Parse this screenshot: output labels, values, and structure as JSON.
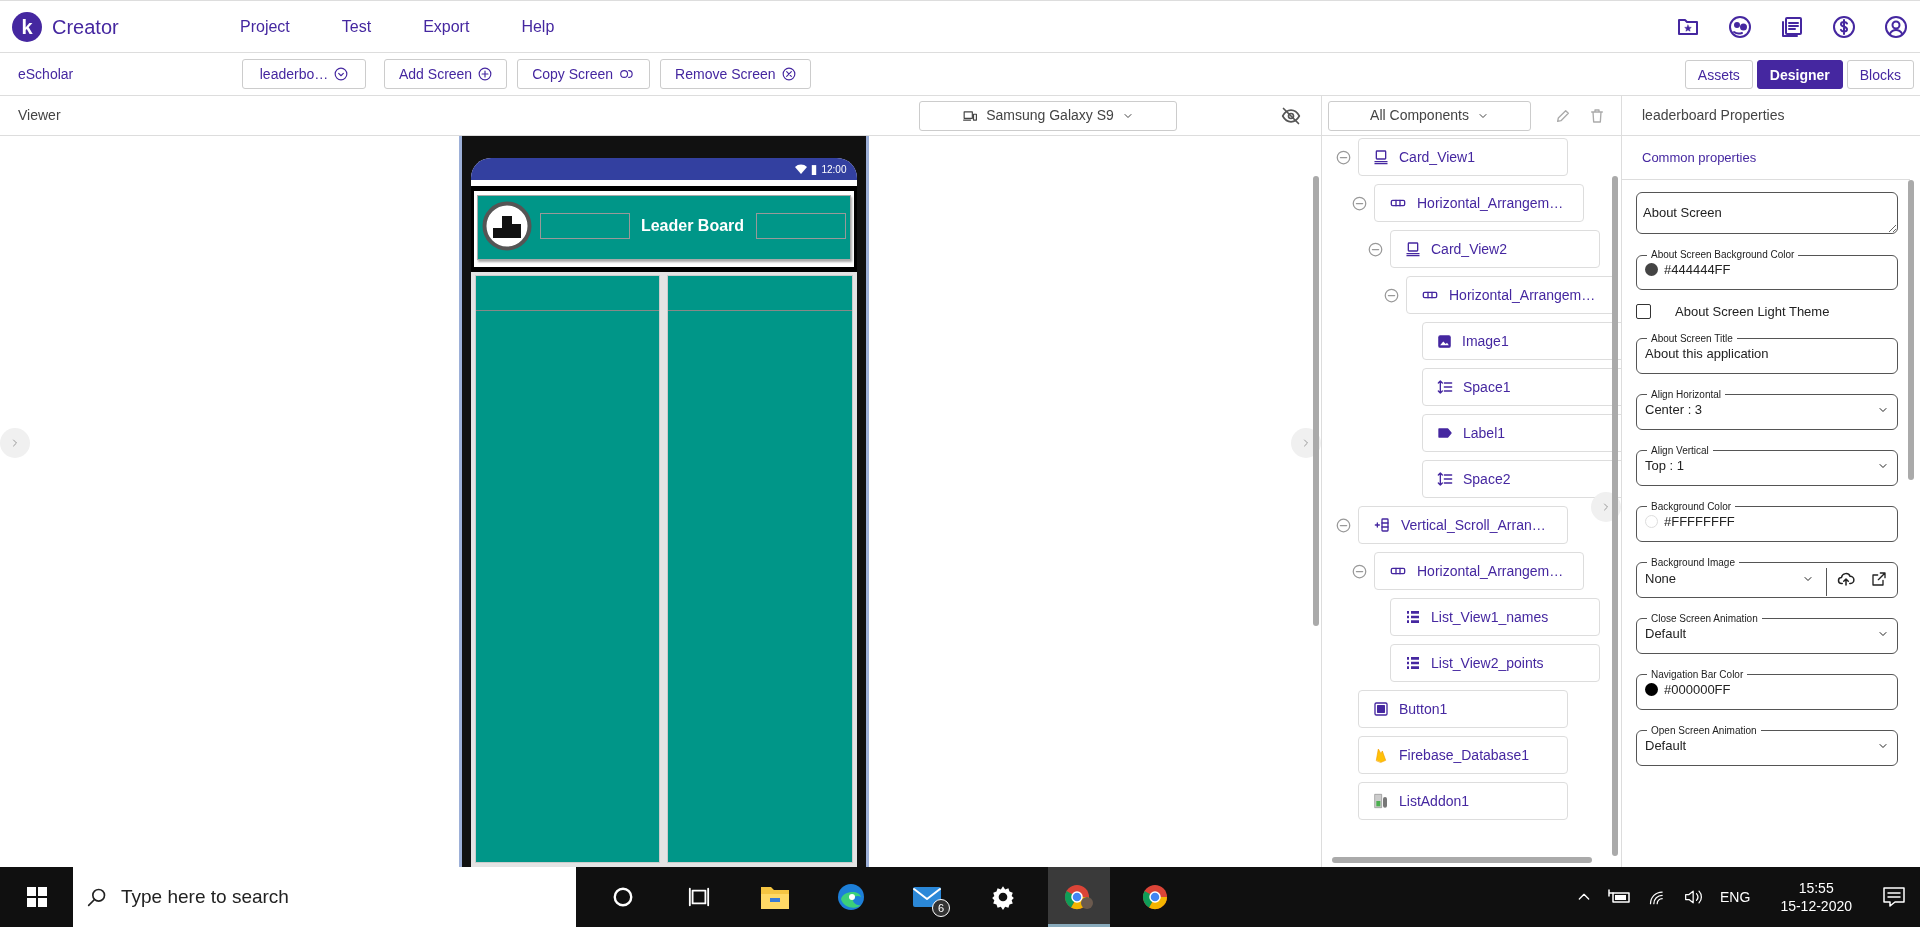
{
  "app": {
    "logo_letter": "k",
    "name": "Creator"
  },
  "menu": [
    "Project",
    "Test",
    "Export",
    "Help"
  ],
  "toolbar": {
    "project": "eScholar",
    "screen_select": "leaderbo…",
    "buttons": [
      {
        "label": "Add Screen",
        "kind": "add"
      },
      {
        "label": "Copy Screen",
        "kind": "copy"
      },
      {
        "label": "Remove Screen",
        "kind": "remove"
      }
    ],
    "views": [
      {
        "label": "Assets",
        "selected": false
      },
      {
        "label": "Designer",
        "selected": true
      },
      {
        "label": "Blocks",
        "selected": false
      }
    ]
  },
  "viewer": {
    "title": "Viewer",
    "device": "Samsung Galaxy S9",
    "phone": {
      "time": "12:00",
      "header_title": "Leader Board"
    }
  },
  "components": {
    "filter": "All Components",
    "tree": [
      {
        "label": "Card_View1",
        "kind": "card",
        "expanded": true,
        "children": [
          {
            "label": "Horizontal_Arrangem…",
            "kind": "horizontal",
            "expanded": true,
            "children": [
              {
                "label": "Card_View2",
                "kind": "card",
                "expanded": true,
                "children": [
                  {
                    "label": "Horizontal_Arrangem…",
                    "kind": "horizontal",
                    "expanded": true,
                    "children": [
                      {
                        "label": "Image1",
                        "kind": "image"
                      },
                      {
                        "label": "Space1",
                        "kind": "space"
                      },
                      {
                        "label": "Label1",
                        "kind": "label"
                      },
                      {
                        "label": "Space2",
                        "kind": "space"
                      }
                    ]
                  }
                ]
              }
            ]
          }
        ]
      },
      {
        "label": "Vertical_Scroll_Arran…",
        "kind": "vertical-scroll",
        "expanded": true,
        "children": [
          {
            "label": "Horizontal_Arrangem…",
            "kind": "horizontal",
            "expanded": true,
            "children": [
              {
                "label": "List_View1_names",
                "kind": "list"
              },
              {
                "label": "List_View2_points",
                "kind": "list"
              }
            ]
          }
        ]
      },
      {
        "label": "Button1",
        "kind": "button"
      },
      {
        "label": "Firebase_Database1",
        "kind": "firebase"
      },
      {
        "label": "ListAddon1",
        "kind": "addon"
      }
    ]
  },
  "properties": {
    "title": "leaderboard Properties",
    "tab": "Common properties",
    "fields": [
      {
        "kind": "textarea",
        "placeholder": "About Screen"
      },
      {
        "kind": "color",
        "label": "About Screen Background Color",
        "value": "#444444FF",
        "color": "#444444"
      },
      {
        "kind": "checkbox",
        "label": "About Screen Light Theme",
        "checked": false
      },
      {
        "kind": "text",
        "label": "About Screen Title",
        "value": "About this application"
      },
      {
        "kind": "select",
        "label": "Align Horizontal",
        "value": "Center : 3"
      },
      {
        "kind": "select",
        "label": "Align Vertical",
        "value": "Top : 1"
      },
      {
        "kind": "color",
        "label": "Background Color",
        "value": "#FFFFFFFF",
        "color": "#ffffff"
      },
      {
        "kind": "image",
        "label": "Background Image",
        "value": "None"
      },
      {
        "kind": "select",
        "label": "Close Screen Animation",
        "value": "Default"
      },
      {
        "kind": "color",
        "label": "Navigation Bar Color",
        "value": "#000000FF",
        "color": "#000000"
      },
      {
        "kind": "select",
        "label": "Open Screen Animation",
        "value": "Default"
      }
    ]
  },
  "taskbar": {
    "search_placeholder": "Type here to search",
    "apps": [
      {
        "kind": "cortana",
        "selected": false
      },
      {
        "kind": "task-view",
        "selected": false
      },
      {
        "kind": "explorer",
        "selected": false
      },
      {
        "kind": "edge",
        "selected": false
      },
      {
        "kind": "mail",
        "selected": false,
        "badge": "6"
      },
      {
        "kind": "settings",
        "selected": false
      },
      {
        "kind": "chrome-profile",
        "selected": true
      },
      {
        "kind": "chrome",
        "selected": false
      }
    ],
    "language": "ENG",
    "time": "15:55",
    "date": "15-12-2020"
  }
}
